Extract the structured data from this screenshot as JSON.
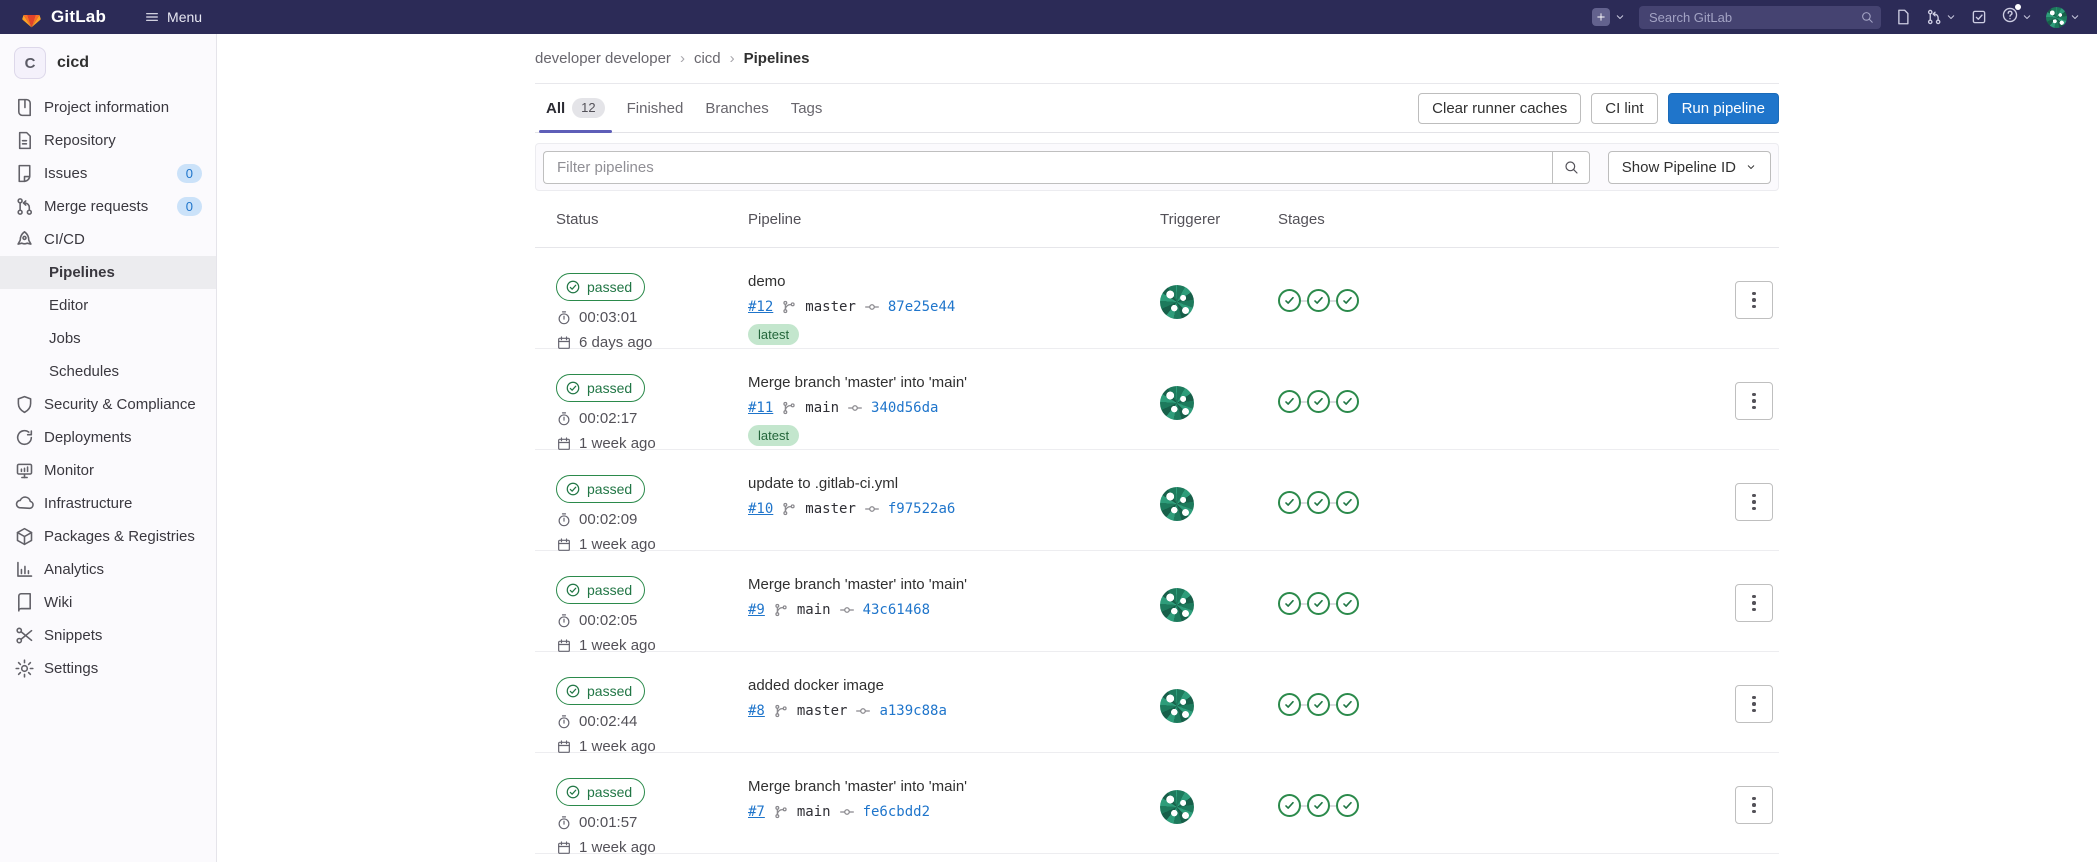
{
  "navbar": {
    "brand": "GitLab",
    "menu_label": "Menu",
    "search_placeholder": "Search GitLab",
    "icons": [
      "plus-icon",
      "chevron-down-icon",
      "search-icon",
      "doc-icon",
      "merge-icon",
      "todo-icon",
      "help-icon",
      "avatar"
    ]
  },
  "sidebar": {
    "project": {
      "initial": "C",
      "name": "cicd"
    },
    "items": [
      {
        "label": "Project information",
        "icon": "book-icon"
      },
      {
        "label": "Repository",
        "icon": "file-icon"
      },
      {
        "label": "Issues",
        "icon": "issues-icon",
        "badge": "0"
      },
      {
        "label": "Merge requests",
        "icon": "merge-icon",
        "badge": "0"
      },
      {
        "label": "CI/CD",
        "icon": "rocket-icon"
      },
      {
        "label": "Pipelines",
        "indent": true,
        "selected": true
      },
      {
        "label": "Editor",
        "indent": true
      },
      {
        "label": "Jobs",
        "indent": true
      },
      {
        "label": "Schedules",
        "indent": true
      },
      {
        "label": "Security & Compliance",
        "icon": "shield-icon"
      },
      {
        "label": "Deployments",
        "icon": "deploy-icon"
      },
      {
        "label": "Monitor",
        "icon": "monitor-icon"
      },
      {
        "label": "Infrastructure",
        "icon": "infra-icon"
      },
      {
        "label": "Packages & Registries",
        "icon": "package-icon"
      },
      {
        "label": "Analytics",
        "icon": "chart-icon"
      },
      {
        "label": "Wiki",
        "icon": "wiki-icon"
      },
      {
        "label": "Snippets",
        "icon": "scissors-icon"
      },
      {
        "label": "Settings",
        "icon": "gear-icon"
      }
    ]
  },
  "breadcrumb": {
    "items": [
      "developer developer",
      "cicd",
      "Pipelines"
    ]
  },
  "tabs": [
    {
      "label": "All",
      "count": "12",
      "active": true
    },
    {
      "label": "Finished"
    },
    {
      "label": "Branches"
    },
    {
      "label": "Tags"
    }
  ],
  "actions": {
    "clear_caches": "Clear runner caches",
    "ci_lint": "CI lint",
    "run_pipeline": "Run pipeline"
  },
  "filter": {
    "placeholder": "Filter pipelines",
    "show_pipeline_id": "Show Pipeline ID"
  },
  "table": {
    "headers": [
      "Status",
      "Pipeline",
      "Triggerer",
      "Stages"
    ],
    "rows": [
      {
        "status": "passed",
        "duration": "00:03:01",
        "age": "6 days ago",
        "title": "demo",
        "id": "#12",
        "branch": "master",
        "hash": "87e25e44",
        "latest": true,
        "stages": [
          "passed",
          "passed",
          "passed"
        ]
      },
      {
        "status": "passed",
        "duration": "00:02:17",
        "age": "1 week ago",
        "title": "Merge branch 'master' into 'main'",
        "id": "#11",
        "branch": "main",
        "hash": "340d56da",
        "latest": true,
        "stages": [
          "passed",
          "passed",
          "passed"
        ]
      },
      {
        "status": "passed",
        "duration": "00:02:09",
        "age": "1 week ago",
        "title": "update to .gitlab-ci.yml",
        "id": "#10",
        "branch": "master",
        "hash": "f97522a6",
        "latest": false,
        "stages": [
          "passed",
          "passed",
          "passed"
        ]
      },
      {
        "status": "passed",
        "duration": "00:02:05",
        "age": "1 week ago",
        "title": "Merge branch 'master' into 'main'",
        "id": "#9",
        "branch": "main",
        "hash": "43c61468",
        "latest": false,
        "stages": [
          "passed",
          "passed",
          "passed"
        ]
      },
      {
        "status": "passed",
        "duration": "00:02:44",
        "age": "1 week ago",
        "title": "added docker image",
        "id": "#8",
        "branch": "master",
        "hash": "a139c88a",
        "latest": false,
        "stages": [
          "passed",
          "passed",
          "passed"
        ]
      },
      {
        "status": "passed",
        "duration": "00:01:57",
        "age": "1 week ago",
        "title": "Merge branch 'master' into 'main'",
        "id": "#7",
        "branch": "main",
        "hash": "fe6cbdd2",
        "latest": false,
        "stages": [
          "passed",
          "passed",
          "passed"
        ]
      }
    ]
  },
  "badges": {
    "latest": "latest"
  },
  "colors": {
    "navbar_bg": "#2c2b57",
    "accent_blue": "#1f75cb",
    "success_green": "#217645",
    "latest_bg": "#c3e6cd",
    "sidebar_bg": "#fbfafd",
    "tab_indicator": "#5e5eb8"
  }
}
